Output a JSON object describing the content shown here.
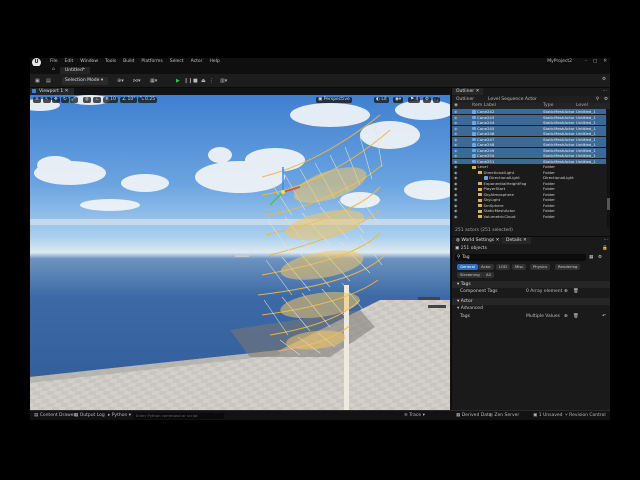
{
  "app": {
    "menu": [
      "File",
      "Edit",
      "Window",
      "Tools",
      "Build",
      "Platforms",
      "Select",
      "Actor",
      "Help"
    ],
    "project_name": "MyProject2",
    "level_tab": "Untitled*",
    "logo_label": "U"
  },
  "toolbar": {
    "mode": "Selection Mode"
  },
  "viewport": {
    "tab": "Viewport 1",
    "perspective": "Perspective",
    "lit": "Lit",
    "snap_grid": "10",
    "snap_angle": "10°",
    "snap_scale": "0.25",
    "cam_speed": "4"
  },
  "statusbar": {
    "content_drawer": "Content Drawer",
    "output_log": "Output Log",
    "cmd": "Python",
    "cmd_placeholder": "Enter Python command or script",
    "trace": "Trace",
    "derived_data": "Derived Data",
    "source_control": "Revision Control",
    "unsaved": "1 Unsaved",
    "zen": "Zen Server"
  },
  "outliner": {
    "tab": "Outliner",
    "subtabs": [
      "Outliner",
      "Level Sequence Actor"
    ],
    "cols": {
      "label": "Item Label",
      "type": "Type",
      "level": "Level"
    },
    "rows": [
      {
        "name": "Cone242",
        "type": "StaticMeshActor",
        "level": "Untitled_1",
        "sel": true,
        "kind": "mesh",
        "indent": 20
      },
      {
        "name": "Cone243",
        "type": "StaticMeshActor",
        "level": "Untitled_1",
        "sel": true,
        "kind": "mesh",
        "indent": 20
      },
      {
        "name": "Cone244",
        "type": "StaticMeshActor",
        "level": "Untitled_1",
        "sel": true,
        "kind": "mesh",
        "indent": 20
      },
      {
        "name": "Cone245",
        "type": "StaticMeshActor",
        "level": "Untitled_1",
        "sel": true,
        "kind": "mesh",
        "indent": 20
      },
      {
        "name": "Cone246",
        "type": "StaticMeshActor",
        "level": "Untitled_1",
        "sel": true,
        "kind": "mesh",
        "indent": 20
      },
      {
        "name": "Cone247",
        "type": "StaticMeshActor",
        "level": "Untitled_1",
        "sel": true,
        "kind": "mesh",
        "indent": 20
      },
      {
        "name": "Cone248",
        "type": "StaticMeshActor",
        "level": "Untitled_1",
        "sel": true,
        "kind": "mesh",
        "indent": 20
      },
      {
        "name": "Cone249",
        "type": "StaticMeshActor",
        "level": "Untitled_1",
        "sel": true,
        "kind": "mesh",
        "indent": 20
      },
      {
        "name": "Cone250",
        "type": "StaticMeshActor",
        "level": "Untitled_1",
        "sel": true,
        "kind": "mesh",
        "indent": 20
      },
      {
        "name": "Cone251",
        "type": "StaticMeshActor",
        "level": "Untitled_1",
        "sel": true,
        "kind": "mesh",
        "indent": 20
      },
      {
        "name": "Level",
        "type": "Folder",
        "level": "",
        "sel": false,
        "kind": "folder",
        "indent": 20
      },
      {
        "name": "DirectionalLight",
        "type": "Folder",
        "level": "",
        "sel": false,
        "kind": "folder",
        "indent": 26
      },
      {
        "name": "DirectionalLight",
        "type": "DirectionalLight",
        "level": "",
        "sel": false,
        "kind": "mesh",
        "indent": 32
      },
      {
        "name": "ExponentialHeightFog",
        "type": "Folder",
        "level": "",
        "sel": false,
        "kind": "folder",
        "indent": 26
      },
      {
        "name": "PlayerStart",
        "type": "Folder",
        "level": "",
        "sel": false,
        "kind": "folder",
        "indent": 26
      },
      {
        "name": "SkyAtmosphere",
        "type": "Folder",
        "level": "",
        "sel": false,
        "kind": "folder",
        "indent": 26
      },
      {
        "name": "SkyLight",
        "type": "Folder",
        "level": "",
        "sel": false,
        "kind": "folder",
        "indent": 26
      },
      {
        "name": "SmSphere",
        "type": "Folder",
        "level": "",
        "sel": false,
        "kind": "folder",
        "indent": 26
      },
      {
        "name": "StaticMeshActor",
        "type": "Folder",
        "level": "",
        "sel": false,
        "kind": "folder",
        "indent": 26
      },
      {
        "name": "VolumetricCloud",
        "type": "Folder",
        "level": "",
        "sel": false,
        "kind": "folder",
        "indent": 26
      }
    ],
    "count": "251 actors (251 selected)"
  },
  "details": {
    "tab_world": "World Settings",
    "tab_details": "Details",
    "objects": "251 objects",
    "search_value": "Tag",
    "filters": [
      "General",
      "Actor",
      "LOD",
      "Misc",
      "Physics",
      "Rendering",
      "Streaming",
      "All"
    ],
    "sections": {
      "tags": "Tags",
      "actor": "Actor",
      "advanced": "Advanced"
    },
    "component_tags_label": "Component Tags",
    "component_tags_value": "0 Array element",
    "tags_label": "Tags",
    "tags_value": "Multiple Values"
  },
  "colors": {
    "accent": "#2f6dbe",
    "selection": "#3d6996",
    "play": "#3ec44a",
    "sculpture": "#f2b63c",
    "sky": "#3f7fd0"
  }
}
